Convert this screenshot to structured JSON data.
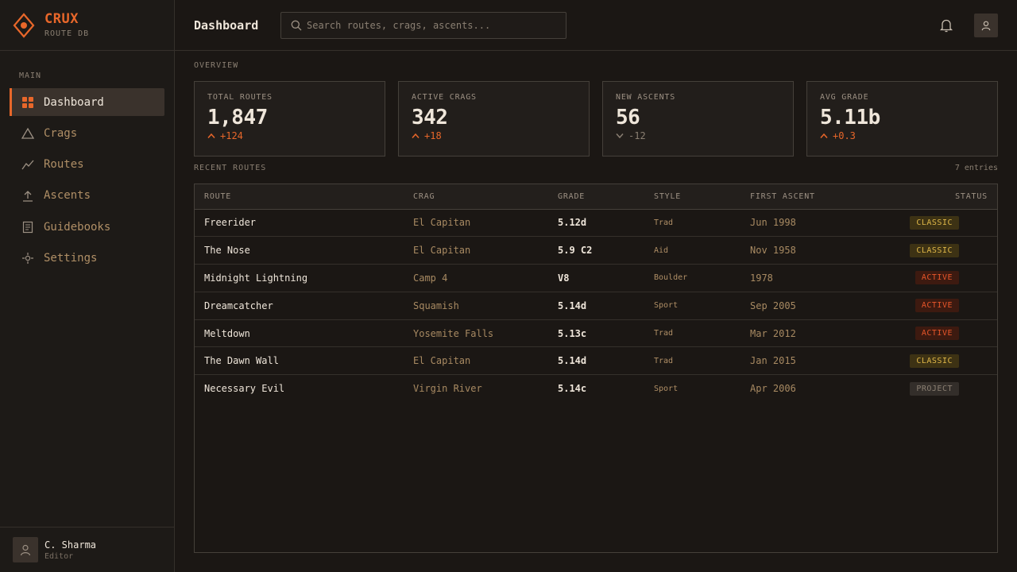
{
  "brand": {
    "name": "CRUX",
    "subtitle": "ROUTE DB"
  },
  "sidebar": {
    "section": "MAIN",
    "items": [
      {
        "label": "Dashboard",
        "icon": "grid-icon",
        "active": true
      },
      {
        "label": "Crags",
        "icon": "triangle-icon"
      },
      {
        "label": "Routes",
        "icon": "trend-line-icon"
      },
      {
        "label": "Ascents",
        "icon": "upload-arrow-icon"
      },
      {
        "label": "Guidebooks",
        "icon": "book-icon"
      },
      {
        "label": "Settings",
        "icon": "gear-icon"
      }
    ]
  },
  "user": {
    "name": "C. Sharma",
    "role": "Editor"
  },
  "header": {
    "title": "Dashboard",
    "search_placeholder": "Search routes, crags, ascents..."
  },
  "overview": {
    "label": "OVERVIEW",
    "stats": [
      {
        "label": "TOTAL ROUTES",
        "value": "1,847",
        "delta": "+124",
        "trend": "up"
      },
      {
        "label": "ACTIVE CRAGS",
        "value": "342",
        "delta": "+18",
        "trend": "up"
      },
      {
        "label": "NEW ASCENTS",
        "value": "56",
        "delta": "-12",
        "trend": "down"
      },
      {
        "label": "AVG GRADE",
        "value": "5.11b",
        "delta": "+0.3",
        "trend": "up"
      }
    ]
  },
  "recent": {
    "label": "RECENT ROUTES",
    "entries": "7 entries",
    "columns": [
      "ROUTE",
      "CRAG",
      "GRADE",
      "STYLE",
      "FIRST ASCENT",
      "STATUS"
    ],
    "rows": [
      {
        "route": "Freerider",
        "crag": "El Capitan",
        "grade": "5.12d",
        "style": "Trad",
        "fa": "Jun 1998",
        "status": "CLASSIC"
      },
      {
        "route": "The Nose",
        "crag": "El Capitan",
        "grade": "5.9 C2",
        "style": "Aid",
        "fa": "Nov 1958",
        "status": "CLASSIC"
      },
      {
        "route": "Midnight Lightning",
        "crag": "Camp 4",
        "grade": "V8",
        "style": "Boulder",
        "fa": "1978",
        "status": "ACTIVE"
      },
      {
        "route": "Dreamcatcher",
        "crag": "Squamish",
        "grade": "5.14d",
        "style": "Sport",
        "fa": "Sep 2005",
        "status": "ACTIVE"
      },
      {
        "route": "Meltdown",
        "crag": "Yosemite Falls",
        "grade": "5.13c",
        "style": "Trad",
        "fa": "Mar 2012",
        "status": "ACTIVE"
      },
      {
        "route": "The Dawn Wall",
        "crag": "El Capitan",
        "grade": "5.14d",
        "style": "Trad",
        "fa": "Jan 2015",
        "status": "CLASSIC"
      },
      {
        "route": "Necessary Evil",
        "crag": "Virgin River",
        "grade": "5.14c",
        "style": "Sport",
        "fa": "Apr 2006",
        "status": "PROJECT"
      }
    ]
  },
  "colors": {
    "accent": "#e8672a",
    "background": "#1b1714",
    "classic": "#e0b848",
    "active": "#e8562a"
  }
}
